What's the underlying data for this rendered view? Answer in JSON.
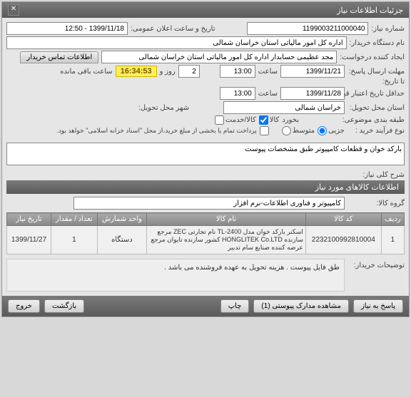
{
  "window": {
    "title": "جزئیات اطلاعات نیاز"
  },
  "fields": {
    "need_no_label": "شماره نیاز:",
    "need_no": "1199003211000040",
    "announce_label": "تاریخ و ساعت اعلان عمومی:",
    "announce_value": "1399/11/18 - 12:50",
    "buyer_label": "نام دستگاه خریدار:",
    "buyer_value": "اداره کل امور مالیاتی استان خراسان شمالی",
    "creator_label": "ایجاد کننده درخواست:",
    "creator_value": "مجد عظیمی حسابدار اداره کل امور مالیاتی استان خراسان شمالی",
    "contact_btn": "اطلاعات تماس خریدار",
    "deadline_send_label": "مهلت ارسال پاسخ:",
    "to_date_label": "تا تاریخ:",
    "deadline_date": "1399/11/21",
    "time_label": "ساعت",
    "deadline_time": "13:00",
    "days_count": "2",
    "and_label": "روز و",
    "countdown": "16:34:53",
    "remaining_label": "ساعت باقی مانده",
    "validity_label": "حداقل تاریخ اعتبار قیمت:",
    "validity_date": "1399/11/28",
    "validity_time": "13:00",
    "delivery_province_label": "استان محل تحویل:",
    "delivery_province": "خراسان شمالی",
    "delivery_city_label": "شهر محل تحویل:",
    "grouping_label": "طبقه بندی موضوعی:",
    "bakhurd_label": "بخورد",
    "kala_label": "کالا",
    "service_label": "کالا/خدمت",
    "buy_process_label": "نوع فرآیند خرید :",
    "small_label": "جزیی",
    "medium_label": "متوسط",
    "payment_note_label": "پرداخت تمام یا بخشی از مبلغ خرید،از محل \"اسناد خزانه اسلامی\" خواهد بود.",
    "desc_label": "شرح کلی نیاز:",
    "desc_value": "بارکد خوان و قطعات کامپیوتر طبق مشخصات پیوست",
    "goods_section": "اطلاعات کالاهای مورد نیاز",
    "goods_group_label": "گروه کالا:",
    "goods_group_value": "کامپیوتر و فناوری اطلاعات-نرم افزار",
    "buyer_notes_label": "توضیحات خریدار:",
    "buyer_notes_value": "طق فایل پیوست . هزینه تحویل به عهده فروشنده می باشد ."
  },
  "table": {
    "headers": {
      "row": "ردیف",
      "code": "کد کالا",
      "name": "نام کالا",
      "unit": "واحد شمارش",
      "qty": "تعداد / مقدار",
      "date": "تاریخ نیاز"
    },
    "rows": [
      {
        "row": "1",
        "code": "2232100992810004",
        "name": "اسکنر بارکد خوان مدل TL-2400 نام تجارتی ZEC مرجع سازنده HONGLITEK Co.LTD کشور سازنده تایوان مرجع عرضه کننده صنایع سام تدبیر",
        "unit": "دستگاه",
        "qty": "1",
        "date": "1399/11/27"
      }
    ]
  },
  "footer": {
    "reply": "پاسخ به نیاز",
    "attachments": "مشاهده مدارک پیوستی (1)",
    "print": "چاپ",
    "back": "بازگشت",
    "exit": "خروج"
  }
}
